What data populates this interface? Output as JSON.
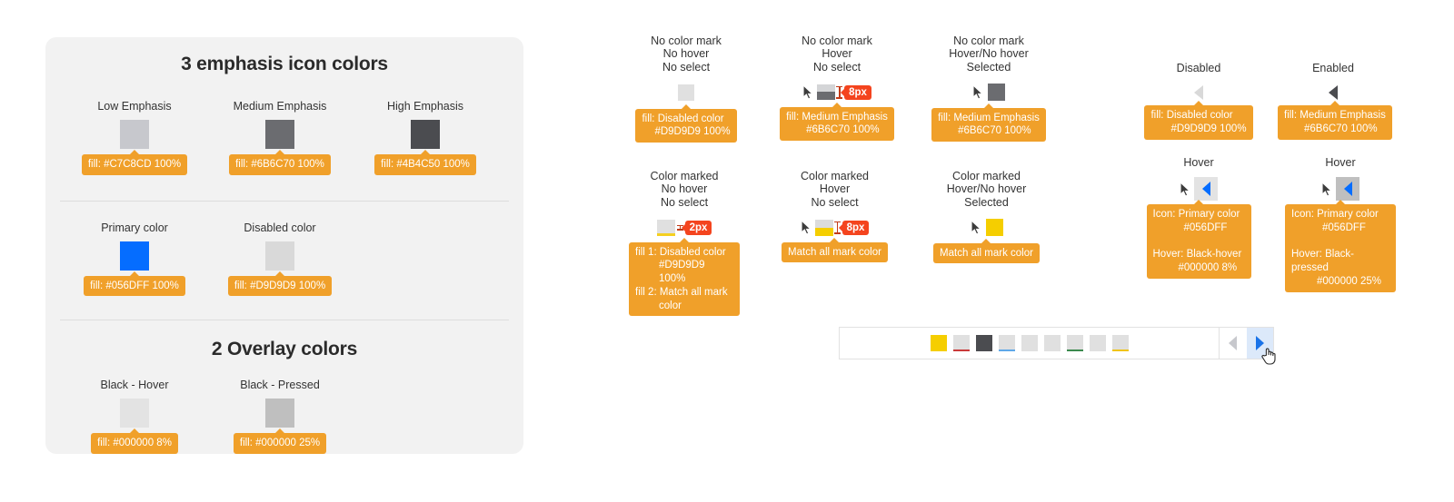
{
  "left_panel": {
    "section1_title": "3 emphasis icon colors",
    "emphasis": [
      {
        "label": "Low Emphasis",
        "swatch": "#C7C8CD",
        "chip": "fill: #C7C8CD 100%"
      },
      {
        "label": "Medium Emphasis",
        "swatch": "#6B6C70",
        "chip": "fill: #6B6C70 100%"
      },
      {
        "label": "High Emphasis",
        "swatch": "#4B4C50",
        "chip": "fill: #4B4C50 100%"
      }
    ],
    "core": [
      {
        "label": "Primary color",
        "swatch": "#056DFF",
        "chip": "fill: #056DFF 100%"
      },
      {
        "label": "Disabled color",
        "swatch": "#D9D9D9",
        "chip": "fill: #D9D9D9 100%"
      }
    ],
    "section2_title": "2 Overlay colors",
    "overlay": [
      {
        "label": "Black - Hover",
        "swatch": "#E3E3E3",
        "chip": "fill: #000000   8%"
      },
      {
        "label": "Black - Pressed",
        "swatch": "#BFBFBF",
        "chip": "fill: #000000   25%"
      }
    ]
  },
  "states": {
    "row1": [
      {
        "desc_line1": "No color mark",
        "desc_line2": "No hover",
        "desc_line3": "No select",
        "cursor": false,
        "swatch_top": "#E0E0E0",
        "swatch_bottom": "",
        "badge": "",
        "chip_line1": "fill: Disabled color",
        "chip_line2": "#D9D9D9 100%"
      },
      {
        "desc_line1": "No color mark",
        "desc_line2": "Hover",
        "desc_line3": "No select",
        "cursor": true,
        "swatch_top": "#D4D5D7",
        "swatch_bottom": "#6B6C70",
        "badge": "8px",
        "chip_line1": "fill: Medium Emphasis",
        "chip_line2": "#6B6C70 100%"
      },
      {
        "desc_line1": "No color mark",
        "desc_line2": "Hover/No hover",
        "desc_line3": "Selected",
        "cursor": true,
        "swatch_top": "#6B6C70",
        "swatch_bottom": "",
        "badge": "",
        "chip_line1": "fill: Medium Emphasis",
        "chip_line2": "#6B6C70 100%"
      }
    ],
    "row2": [
      {
        "desc_line1": "Color marked",
        "desc_line2": "No hover",
        "desc_line3": "No select",
        "cursor": false,
        "swatch_top": "#E0E0E0",
        "swatch_bottom": "#F5D020",
        "bottom_h": 3,
        "badge": "2px",
        "chip_line1": "fill 1: Disabled color",
        "chip_line2": "#D9D9D9 100%",
        "chip_line3": "fill 2: Match all mark",
        "chip_line4": "color"
      },
      {
        "desc_line1": "Color marked",
        "desc_line2": "Hover",
        "desc_line3": "No select",
        "cursor": true,
        "swatch_top": "#DCDCDC",
        "swatch_bottom": "#F5CE00",
        "bottom_h": 9,
        "badge": "8px",
        "chip_line1": "Match all mark color"
      },
      {
        "desc_line1": "Color marked",
        "desc_line2": "Hover/No hover",
        "desc_line3": "Selected",
        "cursor": true,
        "swatch_top": "#F5CE00",
        "swatch_bottom": "",
        "bottom_h": 0,
        "badge": "",
        "chip_line1": "Match all mark color"
      }
    ]
  },
  "arrows": {
    "disabled": {
      "label": "Disabled",
      "arrow_color": "#D9D9D9",
      "chip_line1": "fill: Disabled color",
      "chip_line2": "#D9D9D9 100%"
    },
    "enabled": {
      "label": "Enabled",
      "arrow_color": "#4B4C50",
      "chip_line1": "fill: Medium Emphasis",
      "chip_line2": "#6B6C70 100%"
    },
    "hover_left": {
      "label": "Hover",
      "arrow_color": "#056DFF",
      "bg": "#E3E3E3",
      "chip_line1": "Icon: Primary color",
      "chip_line2": "#056DFF",
      "chip_line3": "Hover: Black-hover",
      "chip_line4": "#000000  8%"
    },
    "hover_right": {
      "label": "Hover",
      "arrow_color": "#056DFF",
      "bg": "#BFBFBF",
      "chip_line1": "Icon: Primary color",
      "chip_line2": "#056DFF",
      "chip_line3": "Hover: Black-pressed",
      "chip_line4": "#000000  25%"
    }
  },
  "palette": {
    "swatches": [
      {
        "fill": "#F5CE00",
        "mark": ""
      },
      {
        "fill": "#E0E0E0",
        "mark": "#C93A3A"
      },
      {
        "fill": "#4B4C50",
        "mark": ""
      },
      {
        "fill": "#E0E0E0",
        "mark": "#5FA8E8"
      },
      {
        "fill": "#E0E0E0",
        "mark": ""
      },
      {
        "fill": "#E0E0E0",
        "mark": ""
      },
      {
        "fill": "#E0E0E0",
        "mark": "#3C8A4E"
      },
      {
        "fill": "#E0E0E0",
        "mark": ""
      },
      {
        "fill": "#E0E0E0",
        "mark": "#F0C419"
      }
    ],
    "prev_arrow_color": "#C7C8CD",
    "next_arrow_color": "#1A73E8",
    "next_bg": "#DCE9FA"
  }
}
